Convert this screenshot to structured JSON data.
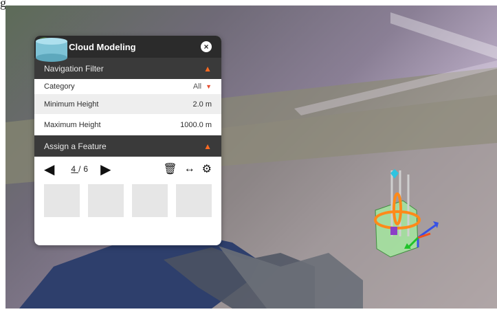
{
  "corner_glyph": "g",
  "panel": {
    "title": "Point Cloud Modeling",
    "close_glyph": "×",
    "navigation_filter": {
      "label": "Navigation Filter",
      "category": {
        "label": "Category",
        "value": "All"
      },
      "min_height": {
        "label": "Minimum Height",
        "value": "2.0 m"
      },
      "max_height": {
        "label": "Maximum Height",
        "value": "1000.0 m"
      }
    },
    "assign_feature": {
      "label": "Assign a Feature",
      "pager": {
        "current": "4",
        "sep": "/",
        "total": "6"
      },
      "features": [
        {
          "icon": "tree-icon"
        },
        {
          "icon": "signpost-icon"
        },
        {
          "icon": "red-sign-icon"
        },
        {
          "icon": "cylinder-tank-icon"
        }
      ]
    }
  },
  "colors": {
    "header_bg": "#2b2b2b",
    "section_bg": "#3a3a3a",
    "accent": "#ff6a22"
  }
}
